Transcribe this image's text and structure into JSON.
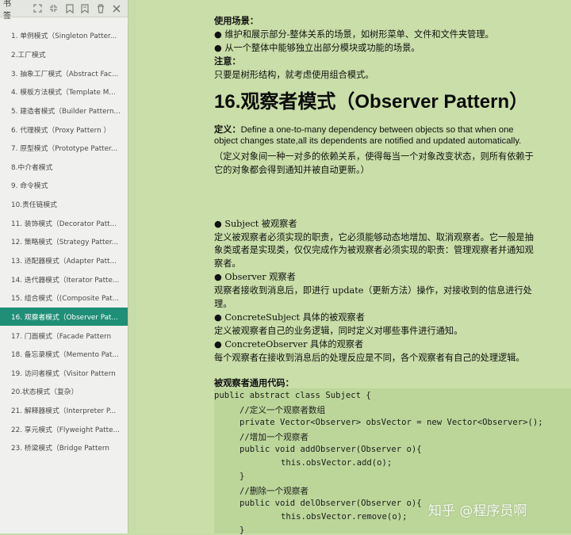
{
  "sidebar": {
    "title": "书签",
    "tools": [
      "expand-all-icon",
      "collapse-all-icon",
      "bookmark-add-icon",
      "bookmark-edit-icon",
      "delete-icon",
      "close-icon"
    ],
    "items": [
      "1. 单例模式（Singleton Patter...",
      "2.工厂模式",
      "3. 抽象工厂模式（Abstract Fac...",
      "4. 模板方法模式（Template M...",
      "5. 建造者模式（Builder Pattern...",
      "6. 代理模式（Proxy Pattern ）",
      "7. 原型模式（Prototype Patter...",
      "8.中介者模式",
      "9. 命令模式",
      "10.责任链模式",
      "11. 装饰模式（Decorator Patt...",
      "12. 策略模式（Strategy Patter...",
      "13. 适配器模式（Adapter Patt...",
      "14. 迭代器模式（Iterator Patte...",
      "15. 组合模式（(Composite Pat...",
      "16. 观察者模式（Observer Pat...",
      "17. 门面模式（Facade Pattern",
      "18. 备忘录模式（Memento Pat...",
      "19. 访问者模式（Visitor Pattern",
      "20.状态模式（复杂）",
      "21. 解释器模式（Interpreter P...",
      "22. 享元模式（Flyweight Patte...",
      "23. 桥梁模式（Bridge Pattern"
    ],
    "active_index": 15
  },
  "doc": {
    "usage_title": "使用场景：",
    "usage_1": "●  维护和展示部分-整体关系的场景，如树形菜单、文件和文件夹管理。",
    "usage_2": "●  从一个整体中能够独立出部分模块或功能的场景。",
    "note_title": "注意：",
    "note_text": "只要是树形结构，就考虑使用组合模式。",
    "heading": "16.观察者模式（Observer Pattern）",
    "def_label": "定义：",
    "def_en_1": "Define a one-to-many dependency between objects so that when one",
    "def_en_2": "object changes state,all its dependents are notified and updated automatically.",
    "def_cn_1": "（定义对象间一种一对多的依赖关系，使得每当一个对象改变状态，则所有依赖于",
    "def_cn_2": "它的对象都会得到通知并被自动更新。）",
    "subject_title": "● Subject 被观察者",
    "subject_1": "定义被观察者必须实现的职责，它必须能够动态地增加、取消观察者。它一般是抽",
    "subject_2": "象类或者是实现类，仅仅完成作为被观察者必须实现的职责：管理观察者并通知观",
    "subject_3": "察者。",
    "observer_title": "● Observer 观察者",
    "observer_1": "观察者接收到消息后，即进行 update（更新方法）操作，对接收到的信息进行处",
    "observer_2": "理。",
    "csubject_title": "● ConcreteSubject 具体的被观察者",
    "csubject_1": "定义被观察者自己的业务逻辑，同时定义对哪些事件进行通知。",
    "cobserver_title": "● ConcreteObserver 具体的观察者",
    "cobserver_1": "每个观察者在接收到消息后的处理反应是不同，各个观察者有自己的处理逻辑。",
    "code_title": "被观察者通用代码："
  },
  "code_lines": [
    "public abstract class Subject {",
    "//定义一个观察者数组",
    "private Vector<Observer> obsVector = new Vector<Observer>();",
    "//增加一个观察者",
    "public void addObserver(Observer o){",
    "this.obsVector.add(o);",
    "}",
    "//删除一个观察者",
    "public void delObserver(Observer o){",
    "this.obsVector.remove(o);",
    "}"
  ],
  "watermark": "知乎 @程序员啊"
}
